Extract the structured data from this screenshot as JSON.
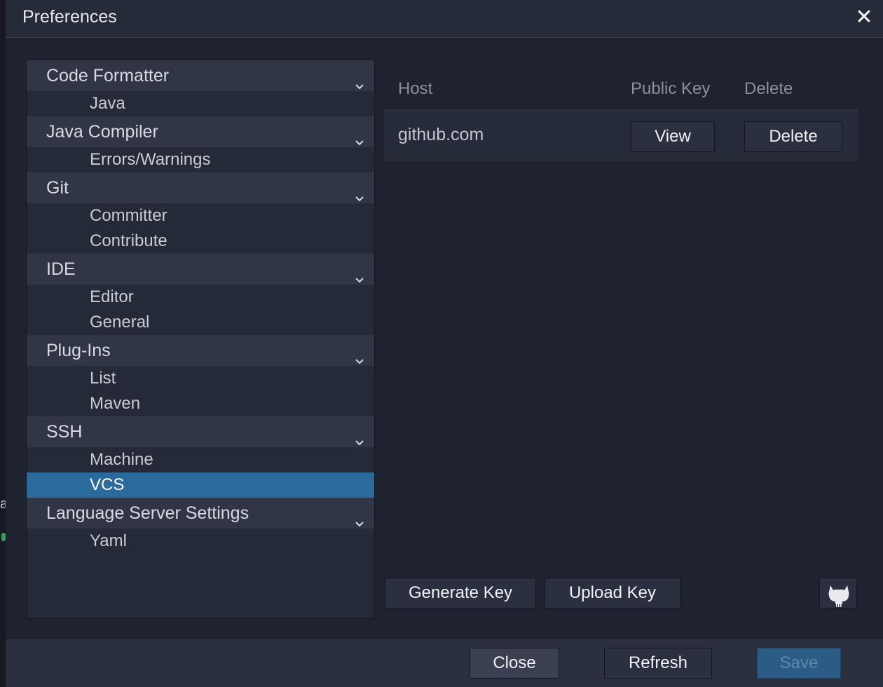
{
  "dialog": {
    "title": "Preferences"
  },
  "tree": {
    "groups": [
      {
        "label": "Code Formatter",
        "children": [
          "Java"
        ]
      },
      {
        "label": "Java Compiler",
        "children": [
          "Errors/Warnings"
        ]
      },
      {
        "label": "Git",
        "children": [
          "Committer",
          "Contribute"
        ]
      },
      {
        "label": "IDE",
        "children": [
          "Editor",
          "General"
        ]
      },
      {
        "label": "Plug-Ins",
        "children": [
          "List",
          "Maven"
        ]
      },
      {
        "label": "SSH",
        "children": [
          "Machine",
          "VCS"
        ]
      },
      {
        "label": "Language Server Settings",
        "children": [
          "Yaml"
        ]
      }
    ],
    "selected": "VCS"
  },
  "keys_table": {
    "headers": [
      "Host",
      "Public Key",
      "Delete"
    ],
    "rows": [
      {
        "host": "github.com",
        "view_label": "View",
        "delete_label": "Delete"
      }
    ]
  },
  "actions": {
    "generate_key": "Generate Key",
    "upload_key": "Upload Key",
    "github_icon": "github-icon"
  },
  "footer": {
    "close": "Close",
    "refresh": "Refresh",
    "save": "Save"
  },
  "colors": {
    "selection": "#2a6b9c",
    "save_disabled": "#2a5c86"
  }
}
